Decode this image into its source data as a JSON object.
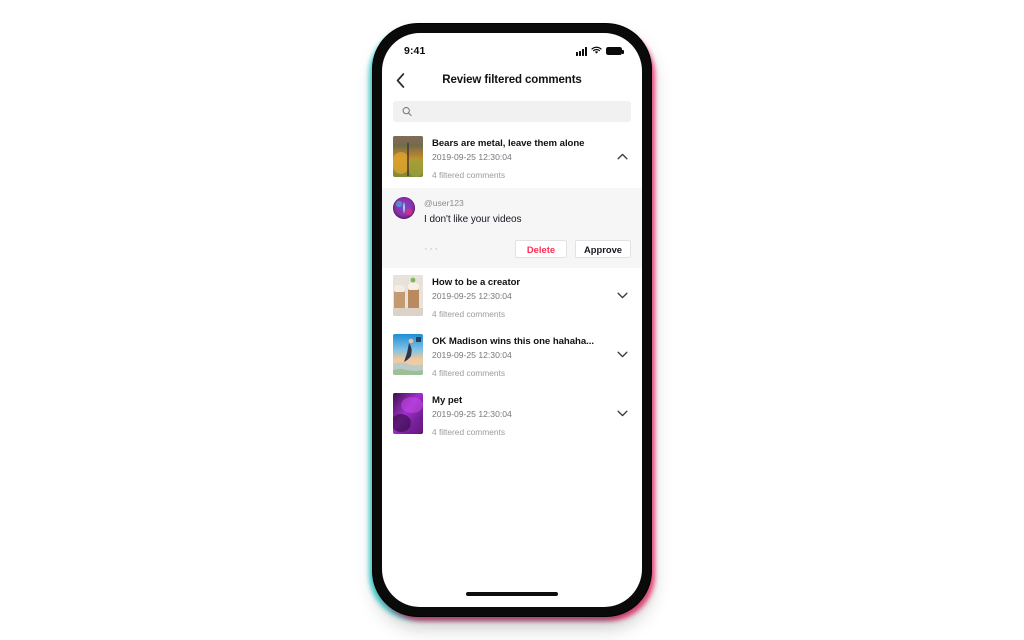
{
  "statusbar": {
    "time": "9:41",
    "signal_icon": "cellular-signal-icon",
    "wifi_icon": "wifi-icon",
    "battery_icon": "battery-full-icon"
  },
  "navbar": {
    "back_icon": "chevron-left-icon",
    "title": "Review filtered comments"
  },
  "search": {
    "icon": "search-icon",
    "value": "",
    "placeholder": ""
  },
  "colors": {
    "accent_delete": "#fe2c55",
    "text_primary": "#161823",
    "text_secondary": "#77777f",
    "text_tertiary": "#9b9ba2",
    "panel_bg": "#f6f6f7",
    "search_bg": "#f1f1f2",
    "frame": "#0a0a0a",
    "glow_teal": "#2ad4d4",
    "glow_pink": "#ff2b6d"
  },
  "videos": [
    {
      "title": "Bears are metal, leave them alone",
      "date": "2019-09-25 12:30:04",
      "filtered_count": "4 filtered comments",
      "expanded": true,
      "chevron_icon": "chevron-up-icon",
      "thumbnail": "autumn-forest-thumbnail"
    },
    {
      "title": "How to be a creator",
      "date": "2019-09-25 12:30:04",
      "filtered_count": "4 filtered comments",
      "expanded": false,
      "chevron_icon": "chevron-down-icon",
      "thumbnail": "iced-coffee-thumbnail"
    },
    {
      "title": "OK Madison wins this one hahaha...",
      "date": "2019-09-25 12:30:04",
      "filtered_count": "4 filtered comments",
      "expanded": false,
      "chevron_icon": "chevron-down-icon",
      "thumbnail": "beach-sunset-thumbnail"
    },
    {
      "title": "My pet",
      "date": "2019-09-25 12:30:04",
      "filtered_count": "4 filtered comments",
      "expanded": false,
      "chevron_icon": "chevron-down-icon",
      "thumbnail": "purple-smoke-thumbnail"
    }
  ],
  "comment": {
    "avatar_icon": "user-avatar",
    "username": "@user123",
    "text": "I don't like your videos",
    "more_label": "···",
    "delete_label": "Delete",
    "approve_label": "Approve"
  },
  "home_indicator": "home-indicator"
}
